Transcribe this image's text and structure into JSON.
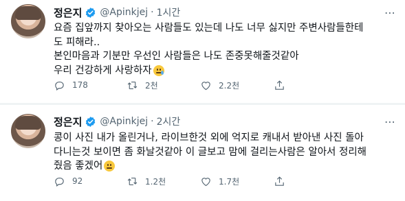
{
  "tweets": [
    {
      "name": "정은지",
      "handle": "@Apinkjej",
      "separator": "·",
      "time": "1시간",
      "lines": [
        "요즘 집앞까지 찾아오는 사람들도 있는데 나도 너무 싫지만 주변사람들한테",
        "도 피해라..",
        "본인마음과 기분만 우선인 사람들은 나도 존중못해줄것같아",
        "우리 건강하게 사랑하자"
      ],
      "end_emoji": "sad-crying-face",
      "reply_count": "178",
      "retweet_count": "2천",
      "like_count": "2.2천"
    },
    {
      "name": "정은지",
      "handle": "@Apinkjej",
      "separator": "·",
      "time": "2시간",
      "lines": [
        "콩이 사진 내가 올린거나, 라이브한것 외에 억지로 캐내서 받아낸 사진 돌아",
        "다니는것 보이면 좀 화날것같아 이 글보고 맘에 걸리는사람은 알아서 정리해",
        "줬음 좋겠어"
      ],
      "end_emoji": "neutral-face",
      "reply_count": "92",
      "retweet_count": "1.2천",
      "like_count": "1.7천"
    }
  ],
  "colors": {
    "verified": "#1d9bf0",
    "muted": "#536471",
    "text": "#0f1419",
    "divider": "#eff3f4"
  },
  "icons": [
    "reply-icon",
    "retweet-icon",
    "like-icon",
    "share-icon",
    "more-icon",
    "verified-badge-icon"
  ]
}
